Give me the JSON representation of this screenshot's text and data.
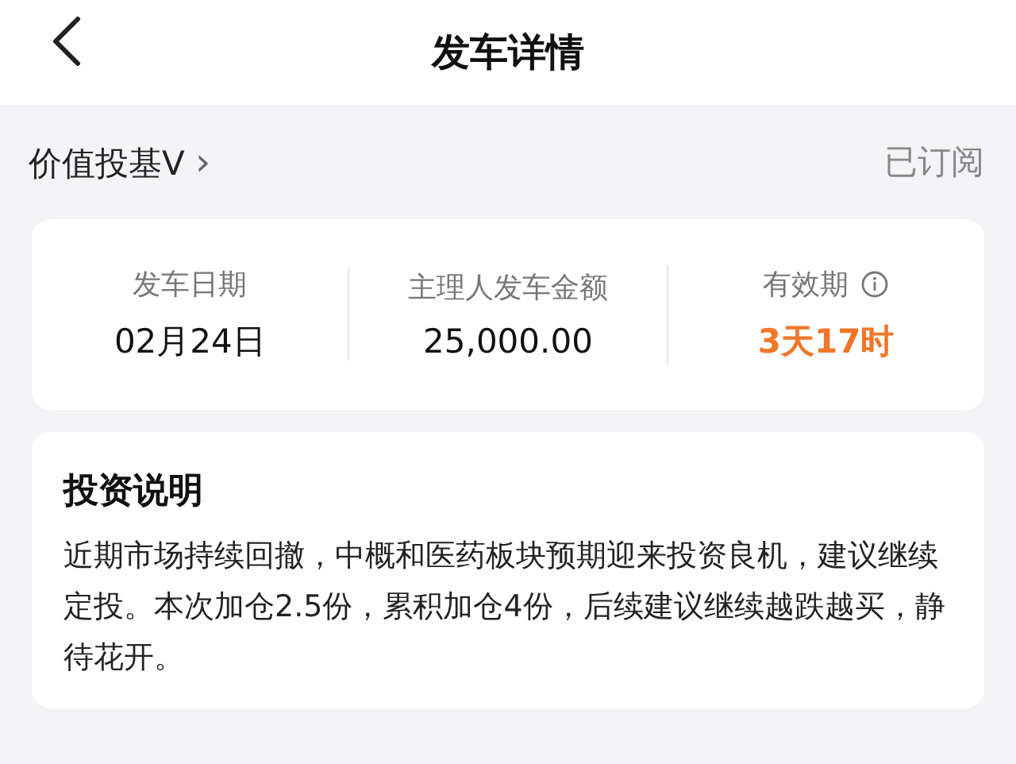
{
  "header": {
    "title": "发车详情"
  },
  "fund": {
    "name": "价值投基V",
    "chevron": "›",
    "status": "已订阅"
  },
  "summary": [
    {
      "label": "发车日期",
      "value": "02月24日",
      "highlight": false,
      "info": false
    },
    {
      "label": "主理人发车金额",
      "value": "25,000.00",
      "highlight": false,
      "info": false
    },
    {
      "label": "有效期",
      "value": "3天17时",
      "highlight": true,
      "info": true
    }
  ],
  "description": {
    "title": "投资说明",
    "text": "近期市场持续回撤，中概和医药板块预期迎来投资良机，建议继续定投。本次加仓2.5份，累积加仓4份，后续建议继续越跌越买，静待花开。"
  }
}
